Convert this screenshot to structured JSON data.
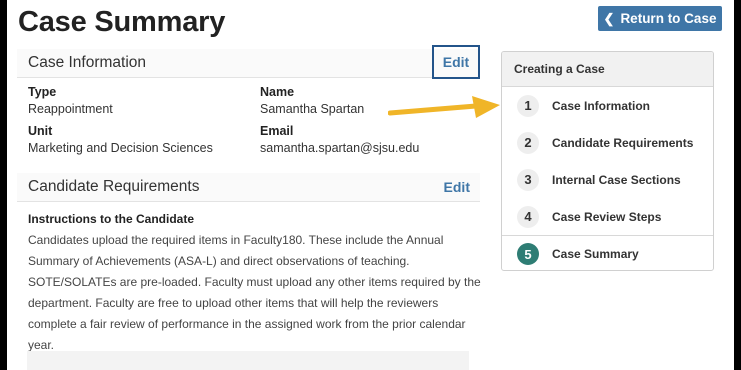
{
  "page": {
    "title": "Case Summary"
  },
  "return_button": {
    "label": "Return to Case",
    "icon": "chevron-left-icon"
  },
  "case_information": {
    "title": "Case Information",
    "edit_label": "Edit",
    "fields": [
      {
        "label": "Type",
        "value": "Reappointment"
      },
      {
        "label": "Name",
        "value": "Samantha Spartan"
      },
      {
        "label": "Unit",
        "value": "Marketing and Decision Sciences"
      },
      {
        "label": "Email",
        "value": "samantha.spartan@sjsu.edu"
      }
    ]
  },
  "candidate_requirements": {
    "title": "Candidate Requirements",
    "edit_label": "Edit",
    "instructions_title": "Instructions to the Candidate",
    "instructions_text": "Candidates upload the required items in Faculty180. These include the Annual Summary of Achievements (ASA-L) and direct observations of teaching. SOTE/SOLATEs are pre-loaded. Faculty must upload any other items required by the department. Faculty are free to upload other items that will help the reviewers complete a fair review of performance in the assigned work from the prior calendar year."
  },
  "steps_panel": {
    "title": "Creating a Case",
    "steps": [
      {
        "number": "1",
        "label": "Case Information"
      },
      {
        "number": "2",
        "label": "Candidate Requirements"
      },
      {
        "number": "3",
        "label": "Internal Case Sections"
      },
      {
        "number": "4",
        "label": "Case Review Steps"
      },
      {
        "number": "5",
        "label": "Case Summary"
      }
    ]
  },
  "colors": {
    "accent": "#3f76a7",
    "edit_highlight_border": "#23548a",
    "active_step": "#2e7d74",
    "annotation_arrow": "#f0b528"
  }
}
